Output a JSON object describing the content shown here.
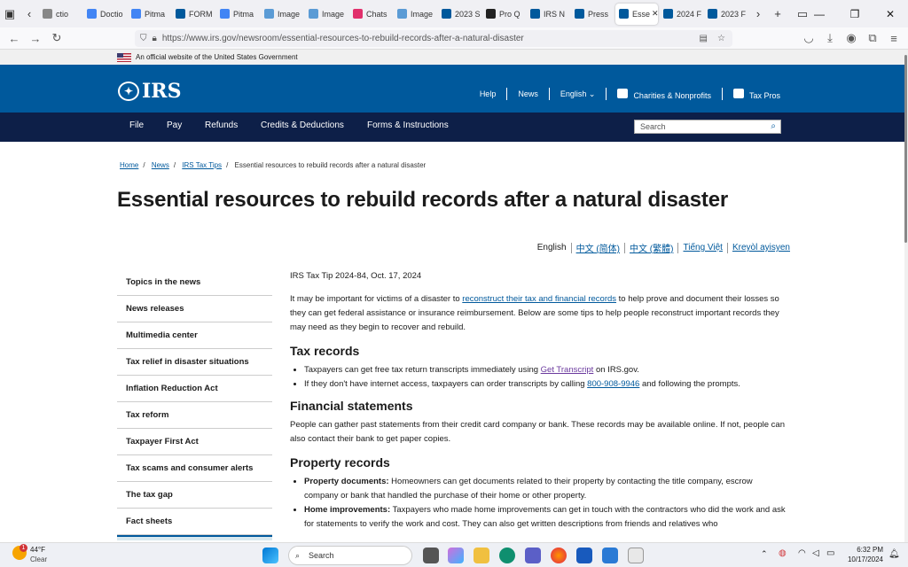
{
  "browser": {
    "tabs": [
      {
        "label": "ctio",
        "color": "#888"
      },
      {
        "label": "Doctio",
        "color": "#4285f4"
      },
      {
        "label": "Pitma",
        "color": "#4285f4"
      },
      {
        "label": "FORM",
        "color": "#00599c"
      },
      {
        "label": "Pitma",
        "color": "#4285f4"
      },
      {
        "label": "Image",
        "color": "#5b9bd5"
      },
      {
        "label": "Image",
        "color": "#5b9bd5"
      },
      {
        "label": "Chats",
        "color": "#e1306c"
      },
      {
        "label": "Image",
        "color": "#5b9bd5"
      },
      {
        "label": "2023 S",
        "color": "#00599c"
      },
      {
        "label": "Pro Q",
        "color": "#222"
      },
      {
        "label": "IRS N",
        "color": "#00599c"
      },
      {
        "label": "Press",
        "color": "#00599c"
      },
      {
        "label": "Esse",
        "color": "#00599c",
        "active": true
      },
      {
        "label": "2024 F",
        "color": "#00599c"
      },
      {
        "label": "2023 F",
        "color": "#00599c"
      }
    ],
    "url": "https://www.irs.gov/newsroom/essential-resources-to-rebuild-records-after-a-natural-disaster"
  },
  "gov_banner": "An official website of the United States Government",
  "header": {
    "logo": "IRS",
    "util_nav": [
      "Help",
      "News",
      "English",
      "Charities & Nonprofits",
      "Tax Pros"
    ]
  },
  "main_nav": {
    "items": [
      "File",
      "Pay",
      "Refunds",
      "Credits & Deductions",
      "Forms & Instructions"
    ],
    "search_placeholder": "Search"
  },
  "breadcrumb": [
    "Home",
    "News",
    "IRS Tax Tips",
    "Essential resources to rebuild records after a natural disaster"
  ],
  "title": "Essential resources to rebuild records after a natural disaster",
  "languages": [
    "English",
    "中文 (简体)",
    "中文 (繁體)",
    "Tiếng Việt",
    "Kreyòl ayisyen"
  ],
  "sidebar": [
    "Topics in the news",
    "News releases",
    "Multimedia center",
    "Tax relief in disaster situations",
    "Inflation Reduction Act",
    "Tax reform",
    "Taxpayer First Act",
    "Tax scams and consumer alerts",
    "The tax gap",
    "Fact sheets"
  ],
  "content": {
    "tip_line": "IRS Tax Tip 2024-84, Oct. 17, 2024",
    "intro_before": "It may be important for victims of a disaster to ",
    "intro_link": "reconstruct their tax and financial records",
    "intro_after": " to help prove and document their losses so they can get federal assistance or insurance reimbursement. Below are some tips to help people reconstruct important records they may need as they begin to recover and rebuild.",
    "h_tax": "Tax records",
    "tax_b1_before": "Taxpayers can get free tax return transcripts immediately using ",
    "tax_b1_link": "Get Transcript",
    "tax_b1_after": " on IRS.gov.",
    "tax_b2_before": "If they don't have internet access, taxpayers can order transcripts by calling ",
    "tax_b2_link": "800-908-9946",
    "tax_b2_after": " and following the prompts.",
    "h_fin": "Financial statements",
    "fin_p": "People can gather past statements from their credit card company or bank. These records may be available online. If not, people can also contact their bank to get paper copies.",
    "h_prop": "Property records",
    "prop_b1_label": "Property documents:",
    "prop_b1_text": " Homeowners can get documents related to their property by contacting the title company, escrow company or bank that handled the purchase of their home or other property.",
    "prop_b2_label": "Home improvements:",
    "prop_b2_text": " Taxpayers who made home improvements can get in touch with the contractors who did the work and ask for statements to verify the work and cost. They can also get written descriptions from friends and relatives who"
  },
  "taskbar": {
    "weather_temp": "44°F",
    "weather_desc": "Clear",
    "search": "Search",
    "time": "6:32 PM",
    "date": "10/17/2024"
  }
}
